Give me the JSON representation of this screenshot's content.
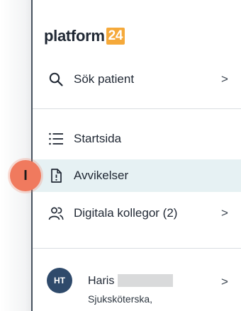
{
  "logo": {
    "word": "platform",
    "badge": "24"
  },
  "colors": {
    "accent": "#f5a93a",
    "active_bg": "#e6f1f3",
    "avatar_bg": "#2f4a6b",
    "marker": "#f07a5e"
  },
  "nav": {
    "search": {
      "label": "Sök patient",
      "icon": "search-icon",
      "chevron": ">"
    },
    "items": [
      {
        "label": "Startsida",
        "icon": "list-icon"
      },
      {
        "label": "Avvikelser",
        "icon": "document-alert-icon",
        "active": true
      },
      {
        "label": "Digitala kollegor (2)",
        "icon": "people-icon",
        "chevron": ">"
      }
    ]
  },
  "user": {
    "initials": "HT",
    "name": "Haris",
    "role": "Sjuksköterska,",
    "chevron": ">"
  },
  "callout": {
    "label": "I"
  }
}
